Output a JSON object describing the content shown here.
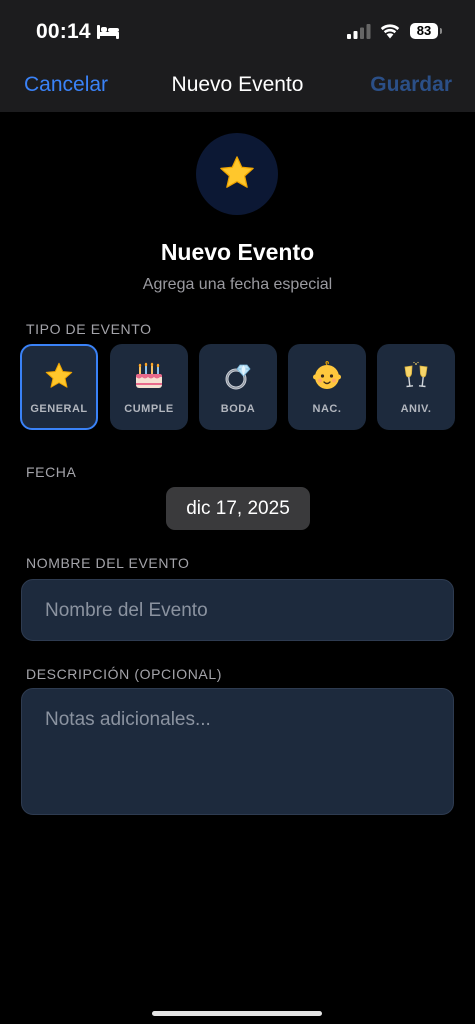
{
  "status_bar": {
    "time": "00:14",
    "battery": "83"
  },
  "nav": {
    "cancel_label": "Cancelar",
    "title": "Nuevo Evento",
    "save_label": "Guardar"
  },
  "header": {
    "icon": "star-icon",
    "title": "Nuevo Evento",
    "subtitle": "Agrega una fecha especial"
  },
  "event_type": {
    "label": "TIPO DE EVENTO",
    "selected": "GENERAL",
    "options": [
      {
        "label": "GENERAL",
        "icon": "star-icon"
      },
      {
        "label": "CUMPLE",
        "icon": "birthday-cake-icon"
      },
      {
        "label": "BODA",
        "icon": "ring-icon"
      },
      {
        "label": "NAC.",
        "icon": "baby-icon"
      },
      {
        "label": "ANIV.",
        "icon": "champagne-icon"
      }
    ]
  },
  "date": {
    "label": "FECHA",
    "value": "dic 17, 2025"
  },
  "name": {
    "label": "NOMBRE DEL EVENTO",
    "placeholder": "Nombre del Evento"
  },
  "description": {
    "label": "DESCRIPCIÓN (OPCIONAL)",
    "placeholder": "Notas adicionales..."
  },
  "colors": {
    "accent": "#3a82f7",
    "save_disabled": "#2b4f87",
    "card": "#1d2a3d",
    "background": "#000000"
  }
}
